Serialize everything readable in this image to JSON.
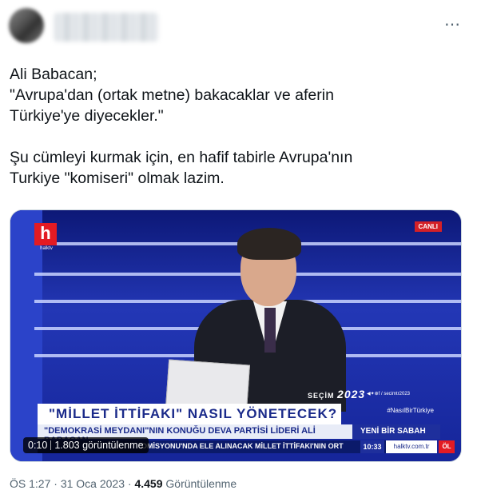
{
  "tweet": {
    "text": "Ali Babacan;\n\"Avrupa'dan (ortak metne) bakacaklar ve aferin\nTürkiye'ye diyecekler.\"\n\nŞu cümleyi kurmak için, en hafif tabirle Avrupa'nın\nTurkiye \"komiseri\" olmak lazim.",
    "more_icon": "⋯"
  },
  "video": {
    "channel_logo": "h",
    "channel_logo_sub": "halktv",
    "live_badge": "CANLI",
    "election_label": "SEÇİM",
    "election_year": "2023",
    "handles": "◀✦⊕f / secimtr2023",
    "hashtag": "#NasılBirTürkiye",
    "headline": "\"MİLLET İTTİFAKI\" NASIL YÖNETECEK?",
    "subheadline": "\"DEMOKRASİ MEYDANI\"NIN KONUĞU DEVA PARTİSİ LİDERİ ALİ BABACAN",
    "program": "YENİ BİR SABAH",
    "ticker": "OMİSYONU'NDA ELE ALINACAK  MİLLET İTTİFAKI'NIN ORT",
    "clock": "10:33",
    "site": "halktv.com.tr",
    "corner_logo": "ÖL",
    "elapsed": "0:10",
    "views_overlay": "1.803 görüntülenme"
  },
  "meta": {
    "time": "ÖS 1:27",
    "separator1": " · ",
    "date": "31 Oca 2023",
    "separator2": " · ",
    "views_count": "4.459",
    "views_label": " Görüntülenme"
  }
}
